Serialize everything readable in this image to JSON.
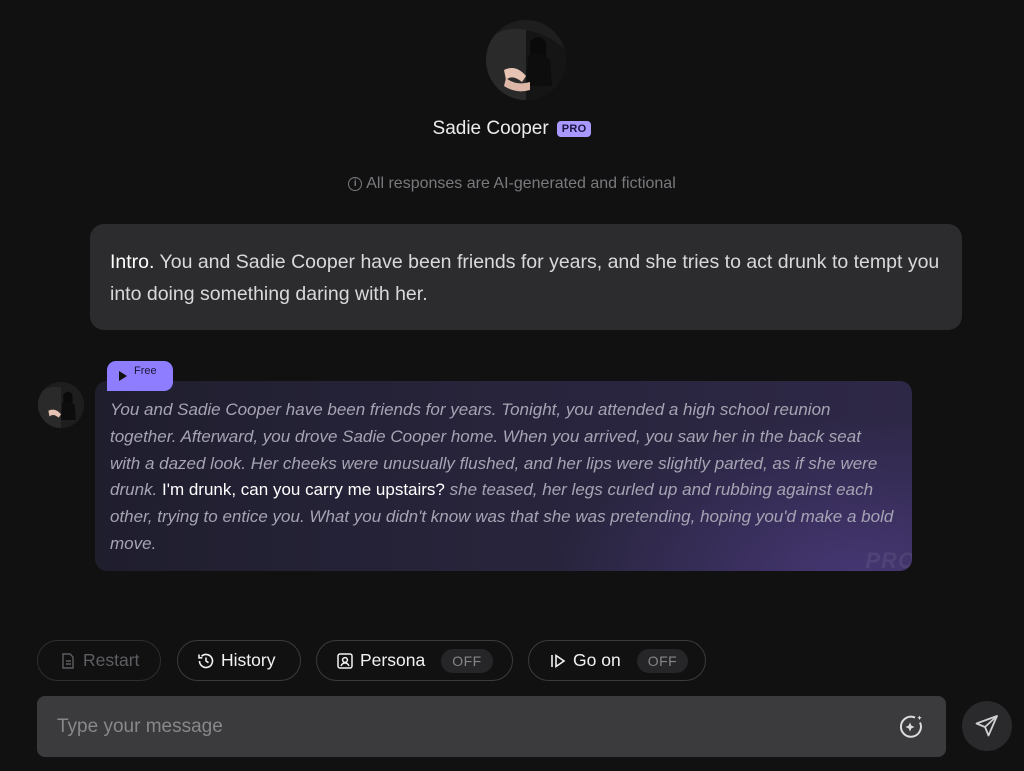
{
  "header": {
    "name": "Sadie Cooper",
    "badge": "PRO",
    "disclaimer": "All responses are AI-generated and fictional"
  },
  "intro": {
    "label": "Intro.",
    "text": " You and Sadie Cooper have been friends for years, and she tries to act drunk to tempt you into doing something daring with her."
  },
  "message": {
    "audio_badge": "Free",
    "narration_1": "You and Sadie Cooper have been friends for years. Tonight, you attended a high school reunion together. Afterward, you drove Sadie Cooper home. When you arrived, you saw her in the back seat with a dazed look. Her cheeks were unusually flushed, and her lips were slightly parted, as if she were drunk. ",
    "speech": "I'm drunk, can you carry me upstairs?",
    "narration_2": " she teased, her legs curled up and rubbing against each other, trying to entice you. What you didn't know was that she was pretending, hoping you'd make a bold move.",
    "watermark": "PRO"
  },
  "actions": {
    "restart": "Restart",
    "history": "History",
    "persona": "Persona",
    "persona_state": "OFF",
    "go_on": "Go on",
    "go_on_state": "OFF"
  },
  "composer": {
    "placeholder": "Type your message"
  },
  "icons": {
    "info": "info-icon",
    "play": "play-icon",
    "restart": "document-icon",
    "history": "history-icon",
    "persona": "persona-card-icon",
    "go_on": "continue-icon",
    "magic": "magic-sparkle-icon",
    "send": "send-icon"
  },
  "colors": {
    "background": "#111112",
    "accent": "#a999ff",
    "intro_card": "#2c2c2e",
    "input": "#3b3b3d"
  }
}
